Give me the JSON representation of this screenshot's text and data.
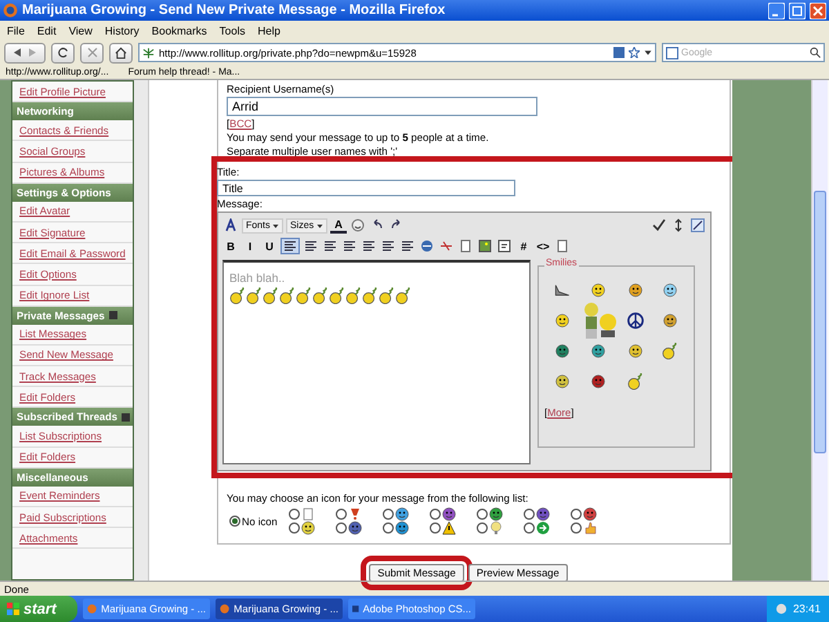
{
  "window": {
    "title": "Marijuana Growing - Send New Private Message - Mozilla Firefox"
  },
  "menu": [
    "File",
    "Edit",
    "View",
    "History",
    "Bookmarks",
    "Tools",
    "Help"
  ],
  "nav": {
    "url": "http://www.rollitup.org/private.php?do=newpm&u=15928",
    "search_placeholder": "Google"
  },
  "bookmarks": [
    "http://www.rollitup.org/...",
    "Forum help thread! - Ma..."
  ],
  "sidebar": [
    {
      "kind": "item",
      "label": "Edit Profile Picture"
    },
    {
      "kind": "header",
      "label": "Networking",
      "collapse_icon": false
    },
    {
      "kind": "item",
      "label": "Contacts & Friends"
    },
    {
      "kind": "item",
      "label": "Social Groups"
    },
    {
      "kind": "item",
      "label": "Pictures & Albums"
    },
    {
      "kind": "header",
      "label": "Settings & Options",
      "collapse_icon": false
    },
    {
      "kind": "item",
      "label": "Edit Avatar"
    },
    {
      "kind": "item",
      "label": "Edit Signature"
    },
    {
      "kind": "item",
      "label": "Edit Email & Password"
    },
    {
      "kind": "item",
      "label": "Edit Options"
    },
    {
      "kind": "item",
      "label": "Edit Ignore List"
    },
    {
      "kind": "header",
      "label": "Private Messages",
      "collapse_icon": true
    },
    {
      "kind": "item",
      "label": "List Messages"
    },
    {
      "kind": "item",
      "label": "Send New Message"
    },
    {
      "kind": "item",
      "label": "Track Messages"
    },
    {
      "kind": "item",
      "label": "Edit Folders"
    },
    {
      "kind": "header",
      "label": "Subscribed Threads",
      "collapse_icon": true
    },
    {
      "kind": "item",
      "label": "List Subscriptions"
    },
    {
      "kind": "item",
      "label": "Edit Folders"
    },
    {
      "kind": "header",
      "label": "Miscellaneous",
      "collapse_icon": false
    },
    {
      "kind": "item",
      "label": "Event Reminders"
    },
    {
      "kind": "item",
      "label": "Paid Subscriptions"
    },
    {
      "kind": "item",
      "label": "Attachments"
    }
  ],
  "recipient": {
    "label": "Recipient Username(s)",
    "value": "Arrid",
    "bcc": {
      "open": "[",
      "link": "BCC",
      "close": "]"
    },
    "hint": "You may send your message to up to **5** people at a time.",
    "hint_2": "Separate multiple user names with ';'"
  },
  "title_field": {
    "label": "Title:",
    "value": "Title"
  },
  "message": {
    "label": "Message:",
    "toolbar_row_1": [
      {
        "kind": "tool"
      },
      {
        "kind": "select",
        "label": "Fonts"
      },
      {
        "kind": "select",
        "label": "Sizes"
      },
      {
        "kind": "color",
        "label": "A"
      },
      {
        "kind": "smile"
      },
      {
        "kind": "undo"
      },
      {
        "kind": "redo"
      }
    ],
    "toolbar_right": [
      {
        "kind": "spell"
      },
      {
        "kind": "resize"
      },
      {
        "kind": "toggle"
      }
    ],
    "toolbar_row_2": [
      {
        "kind": "text",
        "label": "B"
      },
      {
        "kind": "text",
        "label": "I"
      },
      {
        "kind": "text",
        "label": "U"
      },
      {
        "kind": "align",
        "selected": true
      },
      {
        "kind": "align",
        "selected": false
      },
      {
        "kind": "align",
        "selected": false
      },
      {
        "kind": "olist"
      },
      {
        "kind": "ulist"
      },
      {
        "kind": "outdent"
      },
      {
        "kind": "indent"
      },
      {
        "kind": "link"
      },
      {
        "kind": "unlink"
      },
      {
        "kind": "page"
      },
      {
        "kind": "image"
      },
      {
        "kind": "quote"
      },
      {
        "kind": "text",
        "label": "#"
      },
      {
        "kind": "text",
        "label": "<>"
      },
      {
        "kind": "page"
      }
    ],
    "text": "Blah blah..",
    "inserted_smilies": [
      {
        "kind": "smoking"
      },
      {
        "kind": "smoking"
      },
      {
        "kind": "smoking"
      },
      {
        "kind": "smoking"
      },
      {
        "kind": "smoking"
      },
      {
        "kind": "smoking"
      },
      {
        "kind": "smoking"
      },
      {
        "kind": "smoking"
      },
      {
        "kind": "smoking"
      },
      {
        "kind": "smoking"
      },
      {
        "kind": "smoking"
      }
    ],
    "smilies": {
      "title": "Smilies",
      "items": [
        {
          "kind": "pipe"
        },
        {
          "kind": "face",
          "color": "#f0d020"
        },
        {
          "kind": "face",
          "color": "#e0a020"
        },
        {
          "kind": "face",
          "color": "#90d0f0"
        },
        {
          "kind": "face",
          "color": "#f0d020"
        },
        {
          "kind": "figure"
        },
        {
          "kind": "peace"
        },
        {
          "kind": "face",
          "color": "#d0a030"
        },
        {
          "kind": "face",
          "color": "#208060"
        },
        {
          "kind": "face",
          "color": "#30a0a0"
        },
        {
          "kind": "face",
          "color": "#e0c030"
        },
        {
          "kind": "smoking"
        },
        {
          "kind": "face",
          "color": "#d0c040"
        },
        {
          "kind": "face",
          "color": "#b02020"
        },
        {
          "kind": "smoking"
        }
      ],
      "more": {
        "open": "[",
        "link": "More",
        "close": "]"
      }
    }
  },
  "post_icons": {
    "hint": "You may choose an icon for your message from the following list:",
    "no_icon": {
      "label": "No icon",
      "selected": true
    },
    "options": [
      {
        "kind": "page",
        "selected": false
      },
      {
        "kind": "exclaim",
        "selected": false,
        "color": "#d04020"
      },
      {
        "kind": "face",
        "selected": false,
        "color": "#40a0e0"
      },
      {
        "kind": "face",
        "selected": false,
        "color": "#9050c0"
      },
      {
        "kind": "face",
        "selected": false,
        "color": "#30a040"
      },
      {
        "kind": "face",
        "selected": false,
        "color": "#7050c0"
      },
      {
        "kind": "face",
        "selected": false,
        "color": "#d04040"
      },
      {
        "kind": "face",
        "selected": false,
        "color": "#e0d040"
      },
      {
        "kind": "face",
        "selected": false,
        "color": "#5060b0"
      },
      {
        "kind": "face",
        "selected": false,
        "color": "#2090d0"
      },
      {
        "kind": "warning",
        "selected": false,
        "color": "#f0c000"
      },
      {
        "kind": "bulb",
        "selected": false,
        "color": "#f0e080"
      },
      {
        "kind": "arrow",
        "selected": false,
        "color": "#20a040"
      },
      {
        "kind": "thumb",
        "selected": false,
        "color": "#f0b030"
      }
    ]
  },
  "buttons": [
    "Submit Message",
    "Preview Message"
  ],
  "status_bar": "Done",
  "taskbar": {
    "start": "start",
    "tasks": [
      {
        "label": "Marijuana Growing - ...",
        "selected": false,
        "kind": "browser"
      },
      {
        "label": "Marijuana Growing - ...",
        "selected": true,
        "kind": "browser"
      },
      {
        "label": "Adobe Photoshop CS...",
        "selected": false,
        "kind": "photoshop"
      }
    ],
    "time": "23:41"
  }
}
